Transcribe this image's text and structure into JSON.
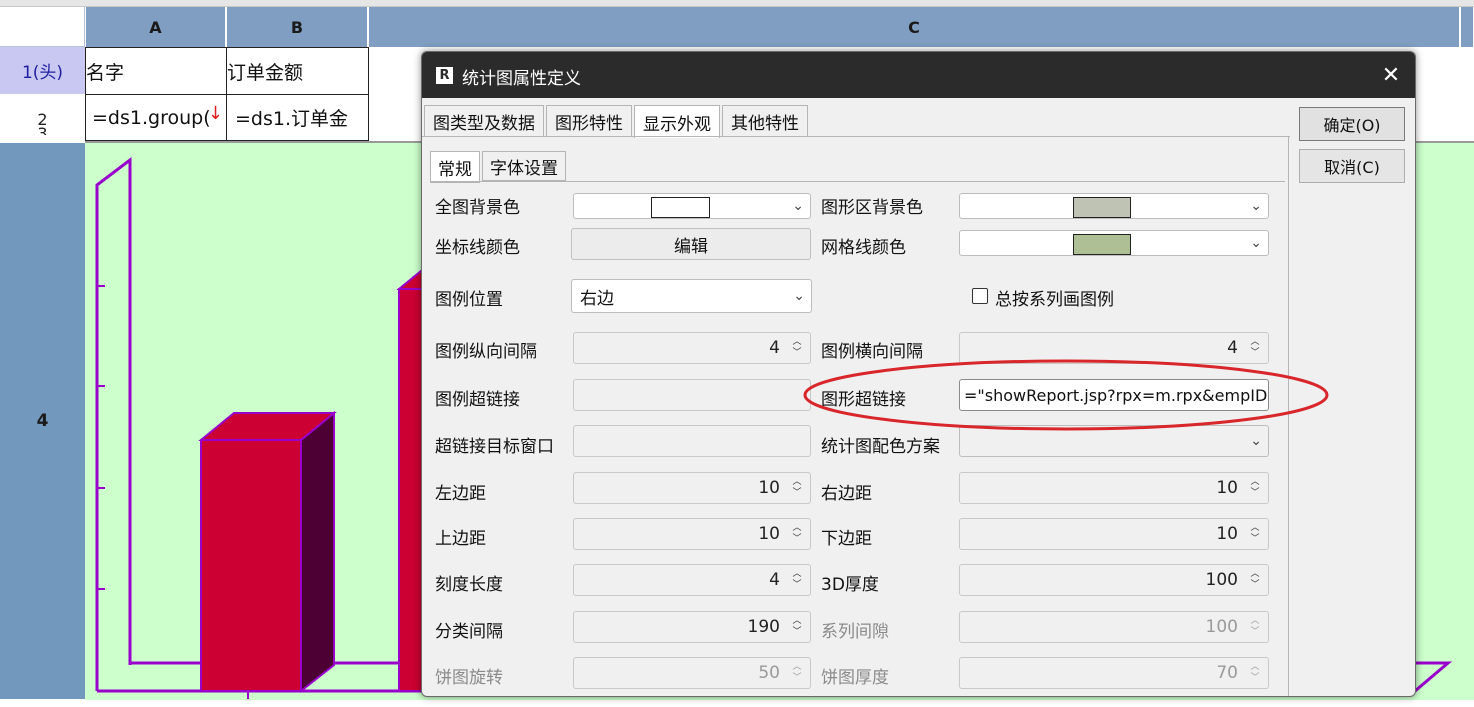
{
  "spreadsheet": {
    "columns": [
      "A",
      "B",
      "C"
    ],
    "rows": {
      "r1": "1(头)",
      "r2": "2",
      "r3": "3",
      "r4": "4"
    },
    "cells": {
      "a1": "名字",
      "b1": "订单金额",
      "a2": "=ds1.group(",
      "b2": "=ds1.订单金"
    }
  },
  "dialog": {
    "title": "统计图属性定义",
    "close_icon": "close-icon",
    "tabs": [
      "图类型及数据",
      "图形特性",
      "显示外观",
      "其他特性"
    ],
    "active_tab": "显示外观",
    "subtabs": [
      "常规",
      "字体设置"
    ],
    "active_subtab": "常规",
    "ok_label": "确定(O)",
    "cancel_label": "取消(C)",
    "fields": {
      "bg_color_label": "全图背景色",
      "plot_bg_label": "图形区背景色",
      "axis_color_label": "坐标线颜色",
      "axis_color_button": "编辑",
      "grid_color_label": "网格线颜色",
      "legend_pos_label": "图例位置",
      "legend_pos_value": "右边",
      "legend_by_series_label": "总按系列画图例",
      "legend_v_gap_label": "图例纵向间隔",
      "legend_v_gap_value": "4",
      "legend_h_gap_label": "图例横向间隔",
      "legend_h_gap_value": "4",
      "legend_link_label": "图例超链接",
      "chart_link_label": "图形超链接",
      "chart_link_value": "=\"showReport.jsp?rpx=m.rpx&empID",
      "link_target_label": "超链接目标窗口",
      "color_scheme_label": "统计图配色方案",
      "left_margin_label": "左边距",
      "left_margin_value": "10",
      "right_margin_label": "右边距",
      "right_margin_value": "10",
      "top_margin_label": "上边距",
      "top_margin_value": "10",
      "bottom_margin_label": "下边距",
      "bottom_margin_value": "10",
      "tick_length_label": "刻度长度",
      "tick_length_value": "4",
      "depth_3d_label": "3D厚度",
      "depth_3d_value": "100",
      "category_gap_label": "分类间隔",
      "category_gap_value": "190",
      "series_gap_label": "系列间隙",
      "series_gap_value": "100",
      "pie_rotate_label": "饼图旋转",
      "pie_rotate_value": "50",
      "pie_depth_label": "饼图厚度",
      "pie_depth_value": "70"
    },
    "colors": {
      "bg_swatch": "#ffffff",
      "plot_swatch": "#bfc3b4",
      "grid_swatch": "#aebf96"
    }
  },
  "colors": {
    "header_blue": "#7f9ec1",
    "chart_bg": "#ccffcc",
    "bar_front": "#cc0033",
    "bar_side": "#4d0033",
    "frame": "#9900cc",
    "annotation_red": "#d8262b"
  }
}
